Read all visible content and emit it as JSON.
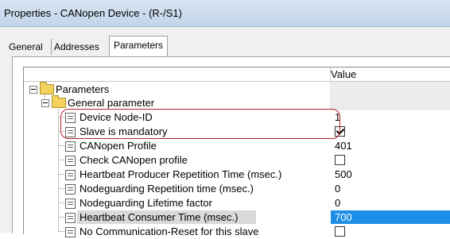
{
  "window": {
    "title": "Properties - CANopen Device - (R-/S1)"
  },
  "tabs": [
    {
      "label": "General"
    },
    {
      "label": "Addresses"
    },
    {
      "label": "Parameters"
    }
  ],
  "grid": {
    "value_header": "Value",
    "root": {
      "label": "Parameters"
    },
    "group": {
      "label": "General parameter"
    },
    "rows": [
      {
        "label": "Device Node-ID",
        "value": "1"
      },
      {
        "label": "Slave is mandatory",
        "value": "checked"
      },
      {
        "label": "CANopen Profile",
        "value": "401"
      },
      {
        "label": "Check CANopen profile",
        "value": "unchecked"
      },
      {
        "label": "Heartbeat Producer Repetition Time (msec.)",
        "value": "500"
      },
      {
        "label": "Nodeguarding Repetition time (msec.)",
        "value": "0"
      },
      {
        "label": "Nodeguarding Lifetime factor",
        "value": "0"
      },
      {
        "label": "Heartbeat Consumer Time (msec.)",
        "value": "700"
      },
      {
        "label": "No Communication-Reset for this slave",
        "value": "unchecked"
      }
    ],
    "selected_row": "Heartbeat Consumer Time (msec.)"
  },
  "colors": {
    "selection": "#1e8ee6",
    "highlight_ring": "#b0232a",
    "titlebar": "#c3d5ea"
  }
}
